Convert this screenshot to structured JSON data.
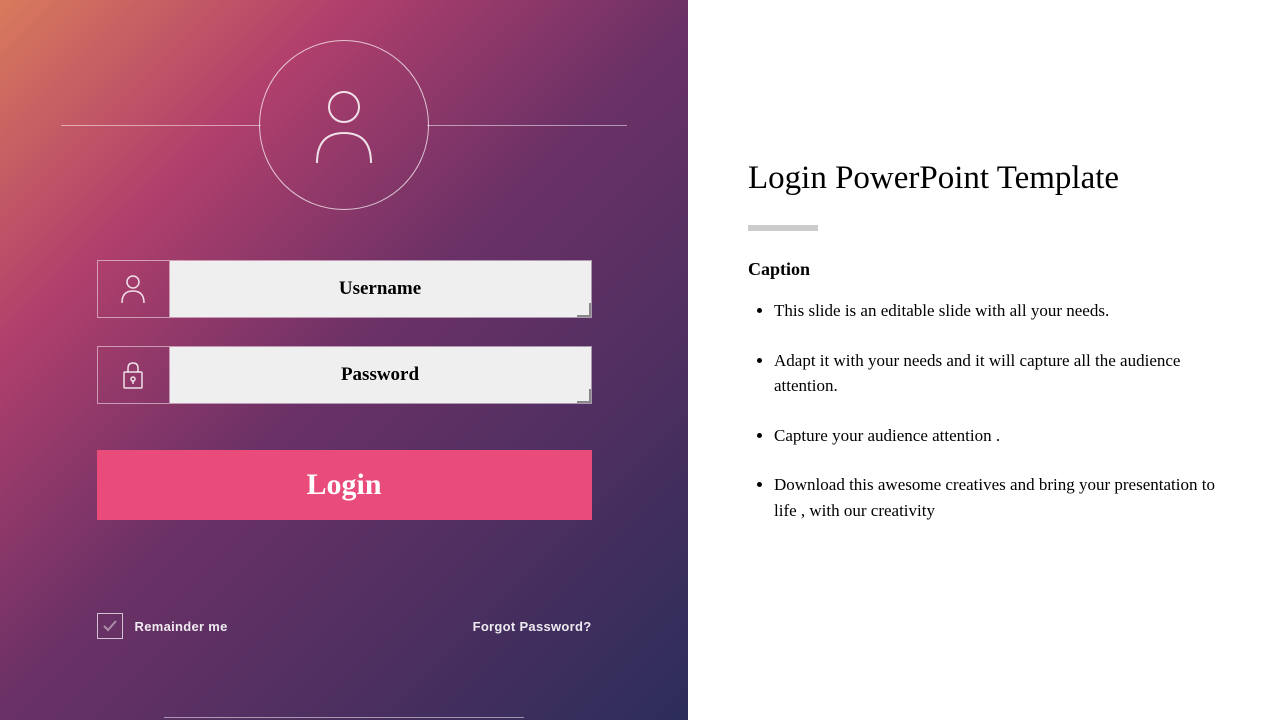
{
  "login": {
    "username_label": "Username",
    "password_label": "Password",
    "button_label": "Login",
    "remember_label": "Remainder me",
    "forgot_label": "Forgot Password?"
  },
  "right": {
    "title": "Login PowerPoint Template",
    "caption": "Caption",
    "bullets": [
      "This slide is an editable slide with all your needs.",
      "Adapt it with your needs and it will capture all the audience attention.",
      "Capture your audience attention .",
      "Download this awesome creatives and bring your presentation to life , with our creativity"
    ]
  }
}
